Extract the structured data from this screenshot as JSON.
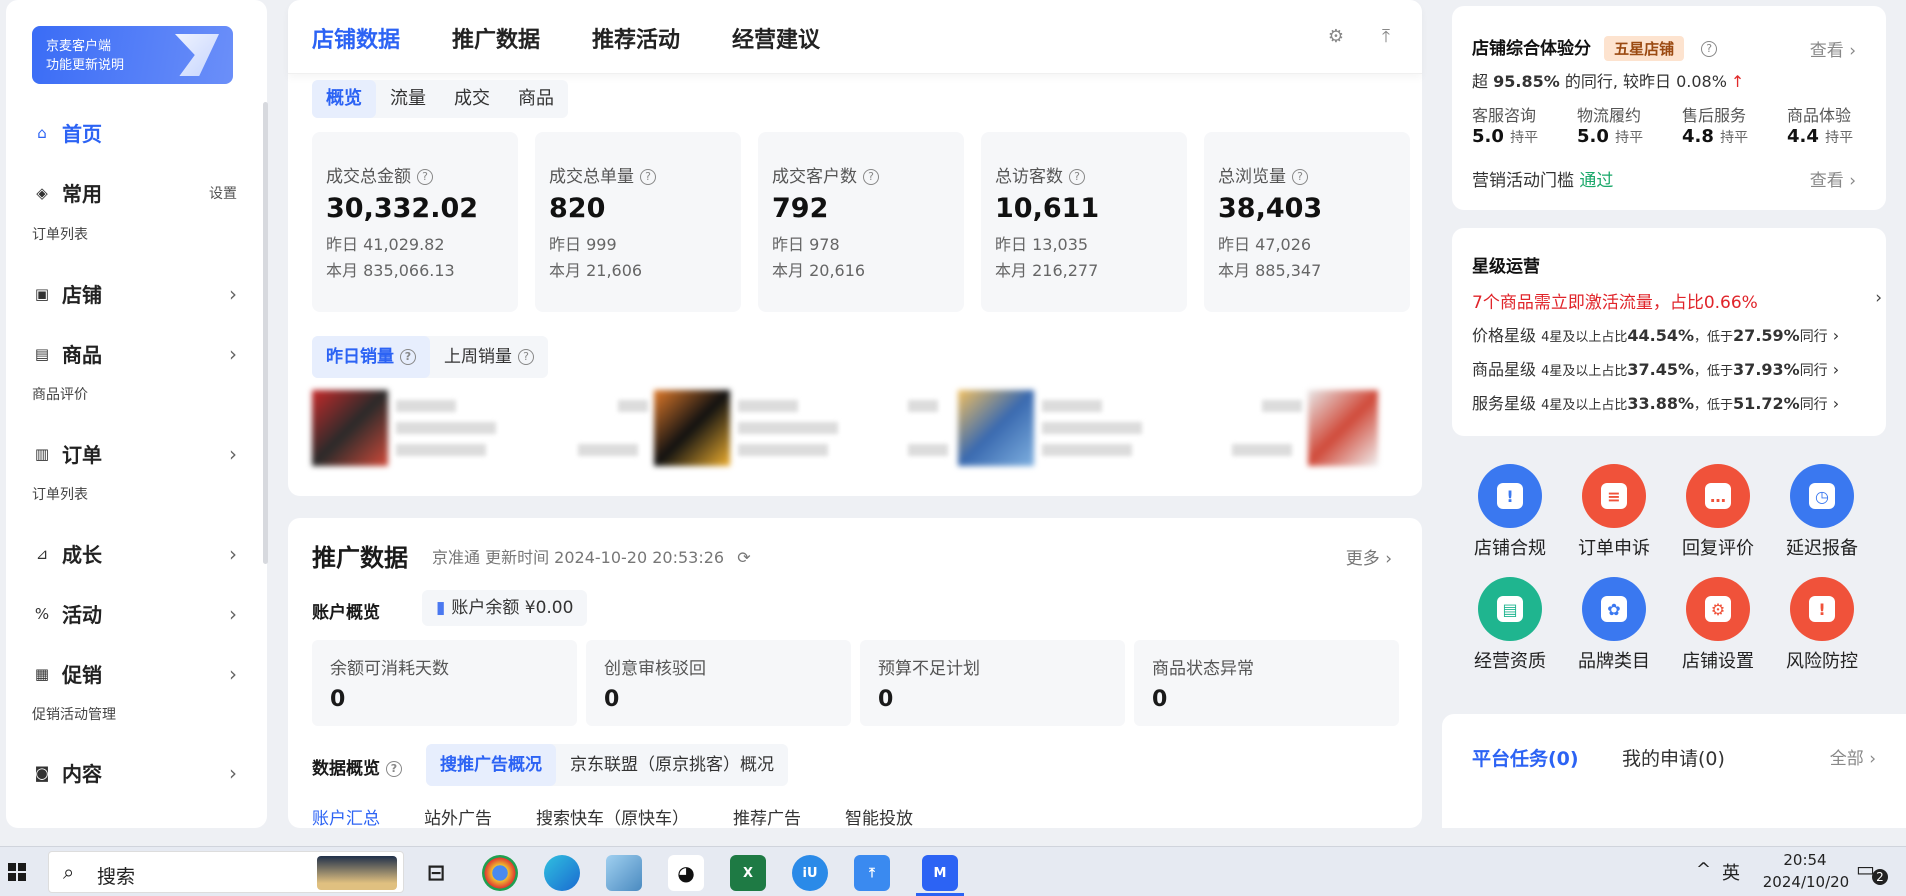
{
  "sidebar": {
    "banner_line1": "京麦客户端",
    "banner_line2": "功能更新说明",
    "items": [
      {
        "label": "首页"
      },
      {
        "label": "常用",
        "action": "设置",
        "sub": "订单列表"
      },
      {
        "label": "店铺"
      },
      {
        "label": "商品",
        "sub": "商品评价"
      },
      {
        "label": "订单",
        "sub": "订单列表"
      },
      {
        "label": "成长"
      },
      {
        "label": "活动"
      },
      {
        "label": "促销",
        "sub": "促销活动管理"
      },
      {
        "label": "内容"
      }
    ]
  },
  "main_tabs": [
    "店铺数据",
    "推广数据",
    "推荐活动",
    "经营建议"
  ],
  "sub_tabs": [
    "概览",
    "流量",
    "成交",
    "商品"
  ],
  "stats": [
    {
      "title": "成交总金额",
      "value": "30,332.02",
      "yesterday": "昨日 41,029.82",
      "month": "本月 835,066.13"
    },
    {
      "title": "成交总单量",
      "value": "820",
      "yesterday": "昨日 999",
      "month": "本月 21,606"
    },
    {
      "title": "成交客户数",
      "value": "792",
      "yesterday": "昨日 978",
      "month": "本月 20,616"
    },
    {
      "title": "总访客数",
      "value": "10,611",
      "yesterday": "昨日 13,035",
      "month": "本月 216,277"
    },
    {
      "title": "总浏览量",
      "value": "38,403",
      "yesterday": "昨日 47,026",
      "month": "本月 885,347"
    }
  ],
  "sales_tabs": [
    "昨日销量",
    "上周销量"
  ],
  "promo": {
    "title": "推广数据",
    "subtitle": "京准通  更新时间 2024-10-20 20:53:26",
    "more": "更多",
    "account_label": "账户概览",
    "balance": "账户余额 ¥0.00",
    "metrics": [
      {
        "title": "余额可消耗天数",
        "value": "0"
      },
      {
        "title": "创意审核驳回",
        "value": "0"
      },
      {
        "title": "预算不足计划",
        "value": "0"
      },
      {
        "title": "商品状态异常",
        "value": "0"
      }
    ],
    "overview_label": "数据概览",
    "overview_tabs": [
      "搜推广告概况",
      "京东联盟（原京挑客）概况"
    ],
    "bottom_tabs": [
      "账户汇总",
      "站外广告",
      "搜索快车（原快车）",
      "推荐广告",
      "智能投放"
    ]
  },
  "score": {
    "title": "店铺综合体验分",
    "badge": "五星店铺",
    "view": "查看",
    "summary_a": "超 ",
    "summary_pct": "95.85%",
    "summary_b": " 的同行, 较昨日 ",
    "summary_delta": "0.08%",
    "summary_arrow": "↑",
    "dims": [
      {
        "name": "客服咨询",
        "score": "5.0",
        "state": "持平"
      },
      {
        "name": "物流履约",
        "score": "5.0",
        "state": "持平"
      },
      {
        "name": "售后服务",
        "score": "4.8",
        "state": "持平"
      },
      {
        "name": "商品体验",
        "score": "4.4",
        "state": "持平"
      }
    ],
    "threshold_label": "营销活动门槛",
    "threshold_status": "通过",
    "view2": "查看"
  },
  "star": {
    "title": "星级运营",
    "alert": "7个商品需立即激活流量，占比0.66%",
    "rows": [
      {
        "name": "价格星级",
        "text": "4星及以上占比",
        "pct": "44.54%",
        "cmp": "，低于",
        "cmp_pct": "27.59%",
        "peer": "同行"
      },
      {
        "name": "商品星级",
        "text": "4星及以上占比",
        "pct": "37.45%",
        "cmp": "，低于",
        "cmp_pct": "37.93%",
        "peer": "同行"
      },
      {
        "name": "服务星级",
        "text": "4星及以上占比",
        "pct": "33.88%",
        "cmp": "，低于",
        "cmp_pct": "51.72%",
        "peer": "同行"
      }
    ]
  },
  "quick": [
    {
      "label": "店铺合规",
      "color": "#3a78f0",
      "glyph": "!"
    },
    {
      "label": "订单申诉",
      "color": "#f0523a",
      "glyph": "≡"
    },
    {
      "label": "回复评价",
      "color": "#f0523a",
      "glyph": "…"
    },
    {
      "label": "延迟报备",
      "color": "#3a78f0",
      "glyph": "◷"
    },
    {
      "label": "经营资质",
      "color": "#1fb58f",
      "glyph": "▤"
    },
    {
      "label": "品牌类目",
      "color": "#3a78f0",
      "glyph": "✿"
    },
    {
      "label": "店铺设置",
      "color": "#f0523a",
      "glyph": "⚙"
    },
    {
      "label": "风险防控",
      "color": "#f0523a",
      "glyph": "!"
    }
  ],
  "tasks": {
    "tab1": "平台任务(0)",
    "tab2": "我的申请(0)",
    "all": "全部"
  },
  "taskbar": {
    "search": "搜索",
    "lang": "英",
    "time": "20:54",
    "date": "2024/10/20",
    "notif": "2"
  }
}
